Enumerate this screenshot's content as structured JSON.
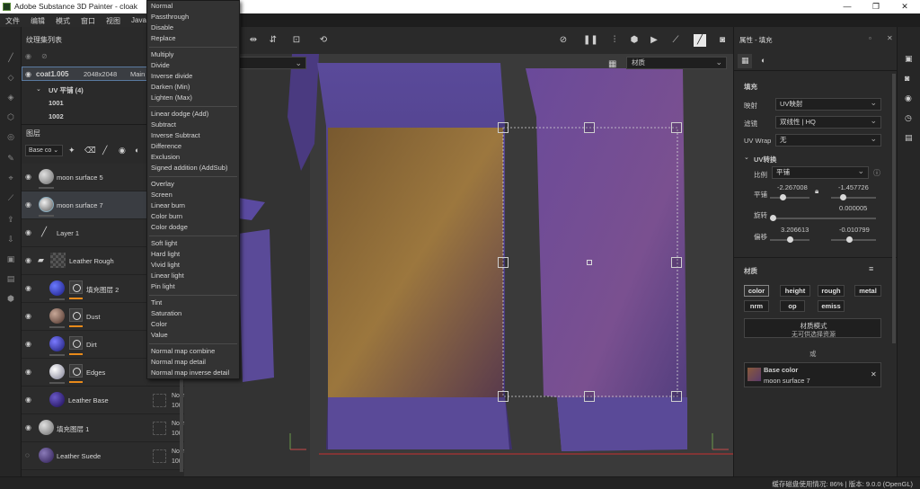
{
  "window": {
    "title": "Adobe Substance 3D Painter - cloak",
    "controls": [
      "—",
      "❐",
      "✕"
    ]
  },
  "menu": [
    "文件",
    "编辑",
    "模式",
    "窗口",
    "视图",
    "Java"
  ],
  "texture_set_panel": {
    "title": "纹理集列表",
    "set_name": "coat1.005",
    "resolution": "2048x2048",
    "shader": "Main",
    "uv_tiles_label": "UV 平铺 (4)",
    "tiles": [
      "1001",
      "1002"
    ]
  },
  "layers_panel": {
    "title": "图层",
    "blend_select": "Base co",
    "layers": [
      {
        "name": "moon surface 5",
        "thumb": "#9a9a9a"
      },
      {
        "name": "moon surface 7",
        "thumb": "#9a9a9a"
      },
      {
        "name": "Layer 1",
        "thumb": "none"
      },
      {
        "name": "Leather Rough",
        "thumb": "folder"
      },
      {
        "name": "填充图层 2",
        "thumb": "#2d2fa8"
      },
      {
        "name": "Dust",
        "thumb": "#8a6a5a"
      },
      {
        "name": "Dirt",
        "thumb": "#3a3aa0"
      },
      {
        "name": "Edges",
        "thumb": "#b0b0c0"
      },
      {
        "name": "Leather Base",
        "thumb": "#3a2a8a"
      },
      {
        "name": "填充图层 1",
        "thumb": "#b0b0b0"
      },
      {
        "name": "Leather Suede",
        "thumb": "#4a3a7a"
      }
    ],
    "blend_labels": [
      {
        "mode": "Norm",
        "opacity": "100"
      },
      {
        "mode": "Norm",
        "opacity": "100"
      },
      {
        "mode": "Norm",
        "opacity": "100"
      }
    ]
  },
  "blend_menu": {
    "groups": [
      [
        "Normal",
        "Passthrough",
        "Disable",
        "Replace"
      ],
      [
        "Multiply",
        "Divide",
        "Inverse divide",
        "Darken (Min)",
        "Lighten (Max)"
      ],
      [
        "Linear dodge (Add)",
        "Subtract",
        "Inverse Subtract",
        "Difference",
        "Exclusion",
        "Signed addition (AddSub)"
      ],
      [
        "Overlay",
        "Screen",
        "Linear burn",
        "Color burn",
        "Color dodge"
      ],
      [
        "Soft light",
        "Hard light",
        "Vivid light",
        "Linear light",
        "Pin light"
      ],
      [
        "Tint",
        "Saturation",
        "Color",
        "Value"
      ],
      [
        "Normal map combine",
        "Normal map detail",
        "Normal map inverse detail"
      ]
    ]
  },
  "viewport": {
    "view_select": "材质"
  },
  "properties": {
    "title": "属性 - 填充",
    "fill_label": "填充",
    "mapping_label": "映射",
    "mapping_value": "UV映射",
    "filter_label": "滤镜",
    "filter_value": "双线性 | HQ",
    "uvwrap_label": "UV Wrap",
    "uvwrap_value": "无",
    "uv_transform_label": "UV转换",
    "scale_label": "比例",
    "scale_value": "平铺",
    "tile_label": "平铺",
    "tile_x": "-2.267008",
    "tile_y": "-1.457726",
    "rotate_label": "旋转",
    "rotate_value": "0.000005",
    "offset_label": "偏移",
    "offset_x": "3.206613",
    "offset_y": "-0.010799",
    "material_label": "材质",
    "channels": [
      "color",
      "height",
      "rough",
      "metal",
      "nrm",
      "op",
      "emiss"
    ],
    "material_mode_title": "材质模式",
    "material_mode_sub": "无可供选择资源",
    "or_label": "或",
    "base_color_label": "Base color",
    "base_color_value": "moon surface 7"
  },
  "status": {
    "text": "缓存磁盘使用情况:  86%  |  版本:  9.0.0 (OpenGL)"
  }
}
